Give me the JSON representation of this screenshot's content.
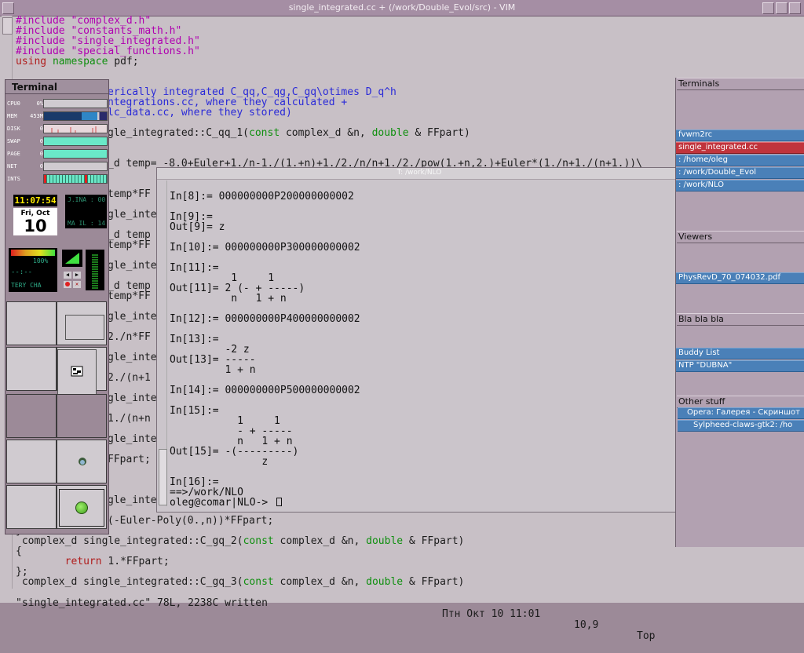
{
  "vim": {
    "title": "single_integrated.cc + (/work/Double_Evol/src) - VIM",
    "includes": [
      "#include \"complex_d.h\"",
      "#include \"constants_math.h\"",
      "#include \"single_integrated.h\"",
      "#include \"special_functions.h\""
    ],
    "using_kw": "using",
    "using_ns": "namespace",
    "using_rest": " pdf;",
    "comment1": "erically integrated C_qq,C_qg,C_gq\\otimes D_q^h",
    "comment2": "ntegrations.cc, where they calculated +",
    "comment3": "lc_data.cc, where they stored)",
    "func1_text": "gle_integrated::C_qq_1(",
    "func1_const": "const",
    "func1_mid": " complex_d &n, ",
    "func1_double": "double",
    "func1_end": " & FFpart)",
    "temp_line": "_d temp= -8.0+Euler+1./n-1./(1.+n)+1./2./n/n+1./2./pow(1.+n,2.)+Euler*(1./n+1./(n+1.))\\",
    "frag1": "temp*FF",
    "frag2": "gle_inte",
    "frag3": "_d temp",
    "frag4": "temp*FF",
    "frag5": "gle_inte",
    "frag6": "_d temp",
    "frag7": "temp*FF",
    "frag8": "gle_inte",
    "frag9": "2./n*FF",
    "frag10": "gle_inte",
    "frag11": "2./(n+1",
    "frag12": "gle_inte",
    "frag13": "1./(n+n",
    "frag14": "gle_inte",
    "frag15": "FFpart;",
    "frag16": "gle_inte",
    "euler_line": "(-Euler-Poly(0.,n))*FFpart;",
    "brace_close": "}",
    "gq2_text": " complex_d single_integrated::C_gq_2(",
    "gq2_const": "const",
    "gq2_mid": " complex_d &n, ",
    "gq2_double": "double",
    "gq2_end": " & FFpart)",
    "brace_open": "{",
    "return_kw": "return",
    "return_rest": " 1.*FFpart;",
    "end_brace": "};",
    "gq3_text": " complex_d single_integrated::C_gq_3(",
    "gq3_const": "const",
    "gq3_mid": " complex_d &n, ",
    "gq3_double": "double",
    "gq3_end": " & FFpart)",
    "status_file": "\"single_integrated.cc\" 78L, 2238C written",
    "status_time": "Птн Окт 10 11:01",
    "status_pos": "10,9",
    "status_scroll": "Top"
  },
  "panel": {
    "title": "Terminal",
    "meters": [
      {
        "label": "CPU0",
        "value": "0%"
      },
      {
        "label": "MEM",
        "value": "453M"
      },
      {
        "label": "DISK",
        "value": "0"
      },
      {
        "label": "SWAP",
        "value": "0"
      },
      {
        "label": "PAGE",
        "value": "0"
      },
      {
        "label": "NET",
        "value": "0"
      },
      {
        "label": "INTS",
        "value": "0"
      }
    ],
    "clock": "11:07:54",
    "date_day": "Fri, Oct",
    "date_num": "10",
    "mail_lines": [
      "J.INA : 00",
      "MA IL : 14"
    ],
    "battery_pct": "100%",
    "battery_time": "--:--",
    "battery_label": "TERY CHA"
  },
  "terminal": {
    "title": "T: /work/NLO",
    "lines": [
      "In[8]:= 000000000P200000000002",
      "",
      "In[9]:=",
      "Out[9]= z",
      "",
      "In[10]:= 000000000P300000000002",
      "",
      "In[11]:=",
      "          1     1",
      "Out[11]= 2 (- + -----)",
      "          n   1 + n",
      "",
      "In[12]:= 000000000P400000000002",
      "",
      "In[13]:=",
      "         -2 z",
      "Out[13]= -----",
      "         1 + n",
      "",
      "In[14]:= 000000000P500000000002",
      "",
      "In[15]:=",
      "           1     1",
      "           - + -----",
      "           n   1 + n",
      "Out[15]= -(---------)",
      "               z",
      "",
      "In[16]:=",
      "==>/work/NLO",
      "oleg@comar|NLO-> "
    ]
  },
  "rpanel": {
    "terminals_title": "Terminals",
    "terminals": [
      "fvwm2rc",
      "single_integrated.cc",
      ": /home/oleg",
      ": /work/Double_Evol",
      ": /work/NLO"
    ],
    "viewers_title": "Viewers",
    "viewers": [
      "PhysRevD_70_074032.pdf"
    ],
    "blabla_title": "Bla bla bla",
    "blabla": [
      "Buddy List",
      "NTP \"DUBNA\""
    ],
    "other_title": "Other stuff",
    "other": [
      "Opera: Галерея - Скриншот",
      "Sylpheed-claws-gtk2: /ho"
    ]
  }
}
